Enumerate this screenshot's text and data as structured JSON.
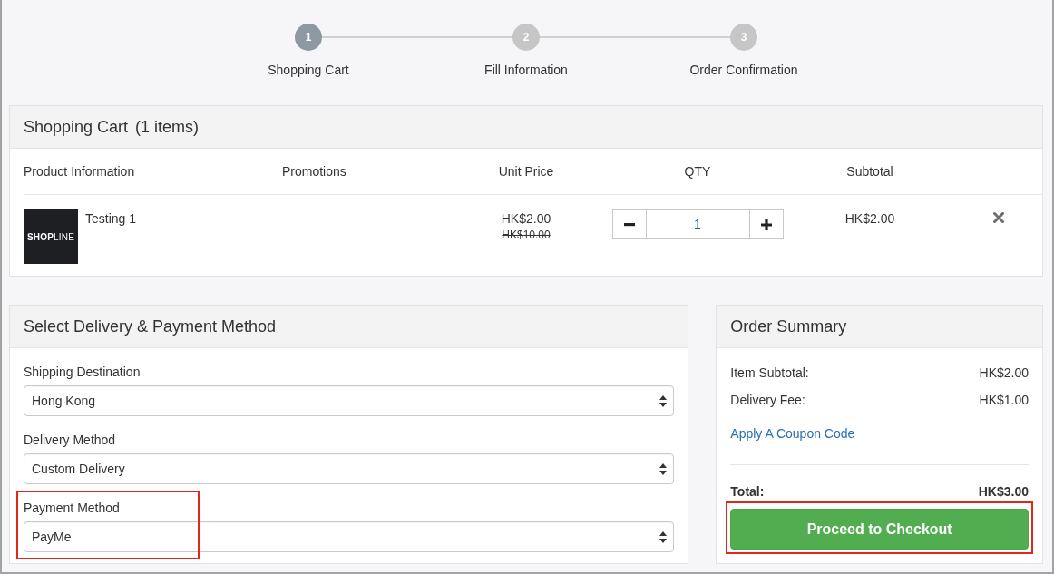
{
  "steps": [
    {
      "number": "1",
      "label": "Shopping Cart",
      "selected": true
    },
    {
      "number": "2",
      "label": "Fill Information",
      "selected": false
    },
    {
      "number": "3",
      "label": "Order Confirmation",
      "selected": false
    }
  ],
  "cart": {
    "title": "Shopping Cart",
    "count": "(1 items)",
    "columns": [
      "Product Information",
      "Promotions",
      "Unit Price",
      "QTY",
      "Subtotal"
    ],
    "items": [
      {
        "thumbnail_logo": "**SHOP**LINE",
        "name": "Testing 1",
        "price": "HK$2.00",
        "original_price": "HK$10.00",
        "quantity": "1",
        "subtotal": "HK$2.00"
      }
    ]
  },
  "delivery": {
    "title": "Select Delivery & Payment Method",
    "fields": [
      {
        "label": "Shipping Destination",
        "value": "Hong Kong",
        "highlighted": false
      },
      {
        "label": "Delivery Method",
        "value": "Custom Delivery",
        "highlighted": false
      },
      {
        "label": "Payment Method",
        "value": "PayMe",
        "highlighted": true
      }
    ]
  },
  "summary": {
    "title": "Order Summary",
    "rows": [
      {
        "label": "Item Subtotal:",
        "value": "HK$2.00"
      },
      {
        "label": "Delivery Fee:",
        "value": "HK$1.00"
      }
    ],
    "coupon_link": "Apply A Coupon Code",
    "total": {
      "label": "Total:",
      "value": "HK$3.00"
    },
    "checkout_button": {
      "label": "Proceed to Checkout",
      "highlighted": true
    }
  }
}
